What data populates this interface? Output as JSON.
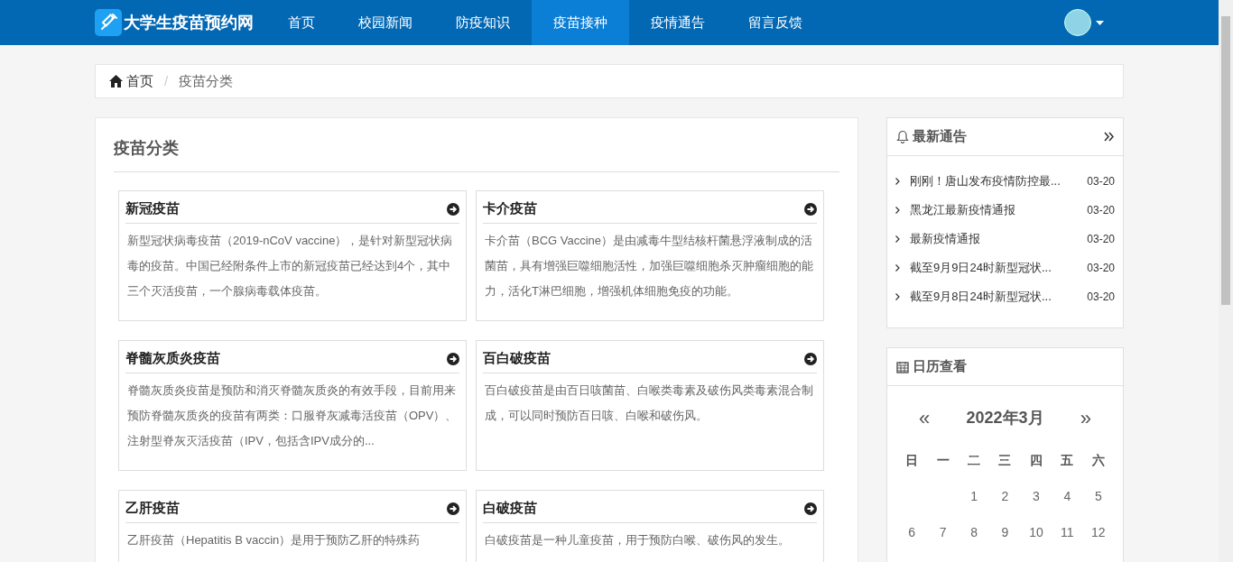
{
  "navbar": {
    "site_title": "大学生疫苗预约网",
    "items": [
      {
        "label": "首页",
        "selected": false
      },
      {
        "label": "校园新闻",
        "selected": false
      },
      {
        "label": "防疫知识",
        "selected": false
      },
      {
        "label": "疫苗接种",
        "selected": true
      },
      {
        "label": "疫情通告",
        "selected": false
      },
      {
        "label": "留言反馈",
        "selected": false
      }
    ]
  },
  "breadcrumb": [
    {
      "label": "首页",
      "kind": "home"
    },
    {
      "label": "疫苗分类",
      "kind": "current",
      "separator": "/"
    }
  ],
  "main": {
    "title": "疫苗分类",
    "cards": [
      {
        "title": "新冠疫苗",
        "body": "新型冠状病毒疫苗（2019-nCoV vaccine），是针对新型冠状病毒的疫苗。中国已经附条件上市的新冠疫苗已经达到4个，其中三个灭活疫苗，一个腺病毒载体疫苗。"
      },
      {
        "title": "卡介疫苗",
        "body": "卡介苗（BCG Vaccine）是由减毒牛型结核杆菌悬浮液制成的活菌苗，具有增强巨噬细胞活性，加强巨噬细胞杀灭肿瘤细胞的能力，活化T淋巴细胞，增强机体细胞免疫的功能。"
      },
      {
        "title": "脊髓灰质炎疫苗",
        "body": "脊髓灰质炎疫苗是预防和消灭脊髓灰质炎的有效手段，目前用来预防脊髓灰质炎的疫苗有两类：口服脊灰减毒活疫苗（OPV）、注射型脊灰灭活疫苗（IPV，包括含IPV成分的..."
      },
      {
        "title": "百白破疫苗",
        "body": "百白破疫苗是由百日咳菌苗、白喉类毒素及破伤风类毒素混合制成，可以同时预防百日咳、白喉和破伤风。"
      },
      {
        "title": "乙肝疫苗",
        "body": "乙肝疫苗（Hepatitis B vaccin）是用于预防乙肝的特殊药"
      },
      {
        "title": "白破疫苗",
        "body": "白破疫苗是一种儿童疫苗，用于预防白喉、破伤风的发生。"
      }
    ]
  },
  "notices": {
    "title": "最新通告",
    "items": [
      {
        "title": "刚刚！唐山发布疫情防控最...",
        "date": "03-20"
      },
      {
        "title": "黑龙江最新疫情通报",
        "date": "03-20"
      },
      {
        "title": "最新疫情通报",
        "date": "03-20"
      },
      {
        "title": "截至9月9日24时新型冠状...",
        "date": "03-20"
      },
      {
        "title": "截至9月8日24时新型冠状...",
        "date": "03-20"
      }
    ]
  },
  "calendar": {
    "title": "日历查看",
    "month": "2022年3月",
    "prev": "«",
    "next": "»",
    "weekdays": [
      "日",
      "一",
      "二",
      "三",
      "四",
      "五",
      "六"
    ],
    "weeks": [
      [
        {
          "kind": "blank"
        },
        {
          "kind": "blank"
        },
        {
          "kind": "day",
          "label": "1"
        },
        {
          "kind": "day",
          "label": "2"
        },
        {
          "kind": "day",
          "label": "3"
        },
        {
          "kind": "day",
          "label": "4"
        },
        {
          "kind": "day",
          "label": "5"
        }
      ],
      [
        {
          "kind": "day",
          "label": "6"
        },
        {
          "kind": "day",
          "label": "7"
        },
        {
          "kind": "day",
          "label": "8"
        },
        {
          "kind": "day",
          "label": "9"
        },
        {
          "kind": "day",
          "label": "10"
        },
        {
          "kind": "day",
          "label": "11"
        },
        {
          "kind": "day",
          "label": "12"
        }
      ]
    ]
  }
}
